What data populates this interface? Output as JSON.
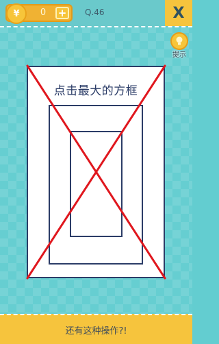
{
  "top_bar": {
    "coin_symbol": "¥",
    "coin_count": "0",
    "add_symbol": "+",
    "level": "Q.46",
    "close_label": "X"
  },
  "hint": {
    "label": "提示",
    "icon": "lightbulb-icon"
  },
  "puzzle": {
    "question": "点击最大的方框",
    "cross_mark_color": "#e0171e"
  },
  "bottom_bar": {
    "message": "还有这种操作?!"
  },
  "colors": {
    "background": "#66ced1",
    "accent_yellow": "#f6c43d",
    "frame_navy": "#2b3c67"
  }
}
